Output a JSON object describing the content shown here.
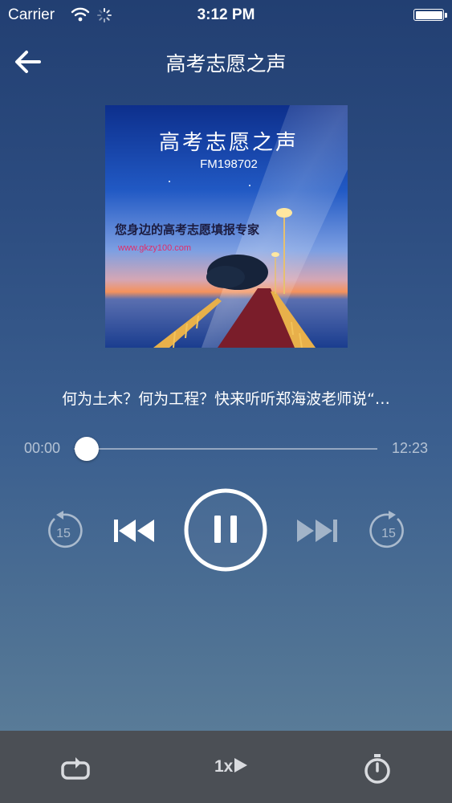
{
  "status_bar": {
    "carrier": "Carrier",
    "time": "3:12 PM"
  },
  "nav": {
    "title": "高考志愿之声",
    "back_icon": "back-arrow-icon"
  },
  "album": {
    "title": "高考志愿之声",
    "subtitle": "FM198702",
    "slogan": "您身边的高考志愿填报专家",
    "url": "www.gkzy100.com"
  },
  "track": {
    "title": "何为土木？何为工程？快来听听郑海波老师说“…"
  },
  "player": {
    "current_time": "00:00",
    "total_time": "12:23",
    "progress": 0.0,
    "rewind_seconds": "15",
    "forward_seconds": "15",
    "state": "playing"
  },
  "bottom_bar": {
    "speed_label": "1x",
    "repeat_icon": "repeat-icon",
    "timer_icon": "timer-icon"
  }
}
